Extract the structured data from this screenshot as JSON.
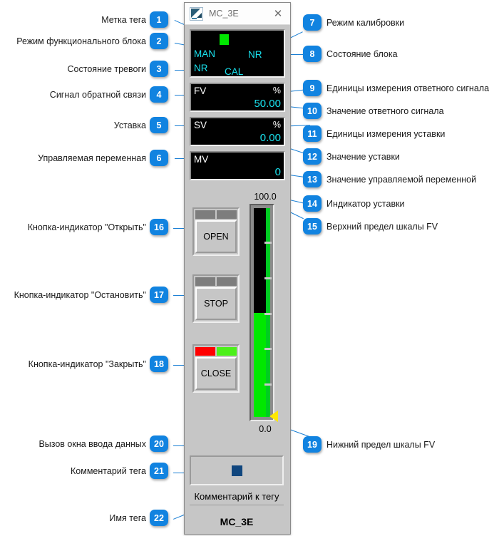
{
  "window": {
    "title": "MC_3E",
    "close_label": "✕",
    "icon": "app-icon"
  },
  "faceplate": {
    "status": {
      "fb_mode": "MAN",
      "alarm_state": "NR",
      "cal_mode": "CAL",
      "block_state": "NR",
      "tag_mark_color": "#00e800"
    },
    "fv": {
      "name": "FV",
      "unit": "%",
      "value": "50.00"
    },
    "sv": {
      "name": "SV",
      "unit": "%",
      "value": "0.00"
    },
    "mv": {
      "name": "MV",
      "unit": "",
      "value": "0"
    },
    "buttons": {
      "open": {
        "label": "OPEN",
        "lamp_left": "#7d7d7d",
        "lamp_right": "#7d7d7d"
      },
      "stop": {
        "label": "STOP",
        "lamp_left": "#7d7d7d",
        "lamp_right": "#7d7d7d"
      },
      "close": {
        "label": "CLOSE",
        "lamp_left": "#ff0000",
        "lamp_right": "#4cf01a"
      }
    },
    "gauge": {
      "scale_high": "100.0",
      "scale_low": "0.0",
      "fv_percent": 50,
      "sv_percent": 0,
      "bar_color": "#00e800",
      "pointer_color": "#ffe800"
    },
    "entry_button": {
      "name": "data-entry"
    },
    "tag_comment": "Комментарий к тегу",
    "tag_name": "MC_3E"
  },
  "annotations": {
    "badge_color": "#1183e0",
    "items": [
      {
        "n": "1",
        "text": "Метка тега"
      },
      {
        "n": "2",
        "text": "Режим функционального блока"
      },
      {
        "n": "3",
        "text": "Состояние тревоги"
      },
      {
        "n": "4",
        "text": "Сигнал обратной связи"
      },
      {
        "n": "5",
        "text": "Уставка"
      },
      {
        "n": "6",
        "text": "Управляемая переменная"
      },
      {
        "n": "7",
        "text": "Режим калибровки"
      },
      {
        "n": "8",
        "text": "Состояние блока"
      },
      {
        "n": "9",
        "text": "Единицы измерения ответного сигнала"
      },
      {
        "n": "10",
        "text": "Значение ответного сигнала"
      },
      {
        "n": "11",
        "text": "Единицы измерения уставки"
      },
      {
        "n": "12",
        "text": "Значение уставки"
      },
      {
        "n": "13",
        "text": "Значение управляемой переменной"
      },
      {
        "n": "14",
        "text": "Индикатор уставки"
      },
      {
        "n": "15",
        "text": "Верхний предел шкалы FV"
      },
      {
        "n": "16",
        "text": "Кнопка-индикатор \"Открыть\""
      },
      {
        "n": "17",
        "text": "Кнопка-индикатор \"Остановить\""
      },
      {
        "n": "18",
        "text": "Кнопка-индикатор \"Закрыть\""
      },
      {
        "n": "19",
        "text": "Нижний предел шкалы FV"
      },
      {
        "n": "20",
        "text": "Вызов окна ввода данных"
      },
      {
        "n": "21",
        "text": "Комментарий тега"
      },
      {
        "n": "22",
        "text": "Имя тега"
      }
    ]
  }
}
